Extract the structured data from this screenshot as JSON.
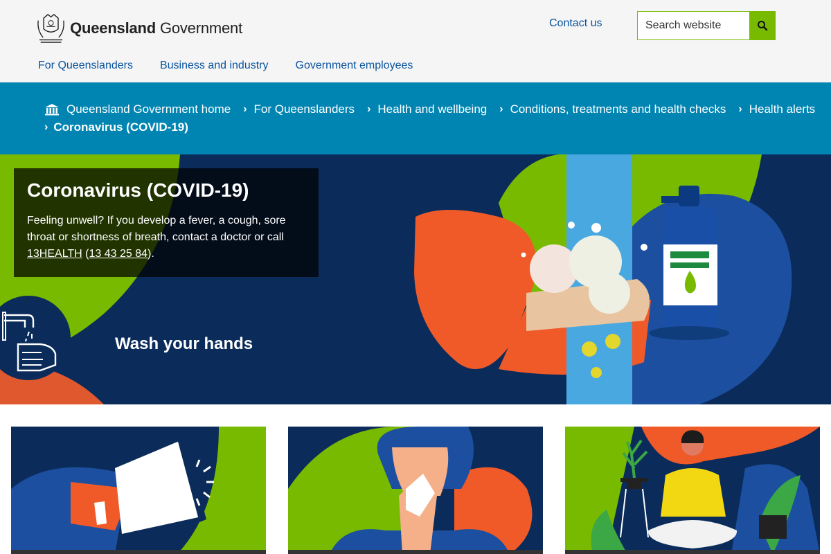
{
  "header": {
    "logo_bold": "Queensland",
    "logo_regular": "Government",
    "contact_label": "Contact us",
    "search_placeholder": "Search website",
    "nav": [
      {
        "label": "For Queenslanders"
      },
      {
        "label": "Business and industry"
      },
      {
        "label": "Government employees"
      }
    ]
  },
  "breadcrumb": {
    "items": [
      {
        "label": "Queensland Government home"
      },
      {
        "label": "For Queenslanders"
      },
      {
        "label": "Health and wellbeing"
      },
      {
        "label": "Conditions, treatments and health checks"
      },
      {
        "label": "Health alerts"
      }
    ],
    "current": "Coronavirus (COVID-19)"
  },
  "hero": {
    "title": "Coronavirus (COVID-19)",
    "text_before": "Feeling unwell? If you develop a fever, a cough, sore throat or shortness of breath, contact a doctor or call ",
    "link1": "13HEALTH",
    "paren_open": " (",
    "link2": "13 43 25 84",
    "text_after": ").",
    "slide_label": "Wash your hands"
  },
  "colors": {
    "link_blue": "#09549f",
    "breadcrumb_bg": "#0085b3",
    "accent_green": "#78ba00",
    "hero_navy": "#0b2c5a",
    "orange": "#f05a28"
  }
}
